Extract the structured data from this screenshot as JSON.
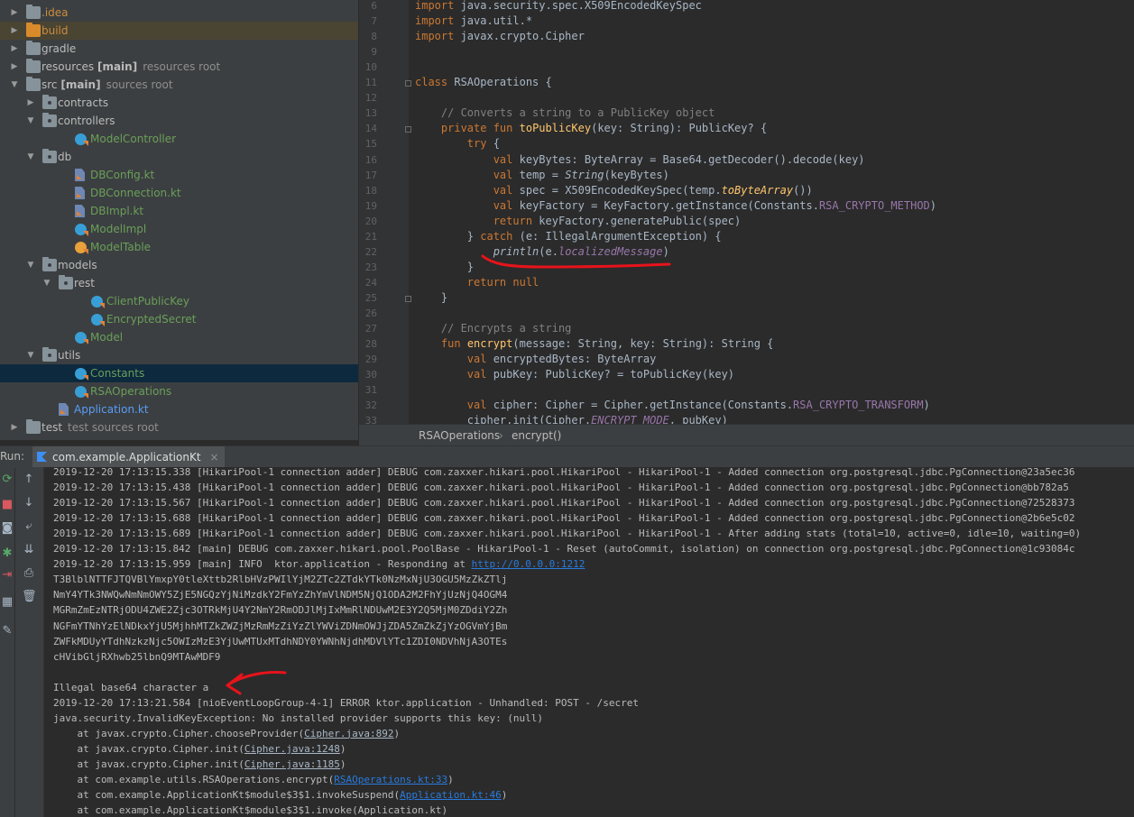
{
  "tree": [
    {
      "label": ".idea",
      "icon": "folder-icon",
      "folder": "gray",
      "arrow": "right",
      "indent": 0,
      "color": "orange",
      "hl": false
    },
    {
      "label": "build",
      "icon": "folder-icon",
      "folder": "orange",
      "arrow": "right",
      "indent": 0,
      "color": "orange",
      "hl": true
    },
    {
      "label": "gradle",
      "icon": "folder-icon",
      "folder": "gray",
      "arrow": "right",
      "indent": 0,
      "color": "gray"
    },
    {
      "label": "resources [main]",
      "hint": "resources root",
      "icon": "folder-icon",
      "folder": "gray",
      "arrow": "right",
      "indent": 0,
      "color": "gray",
      "bold_part": "[main]"
    },
    {
      "label": "src [main]",
      "hint": "sources root",
      "icon": "folder-icon",
      "folder": "gray",
      "arrow": "down",
      "indent": 0,
      "color": "gray",
      "bold_part": "[main]"
    },
    {
      "label": "contracts",
      "icon": "package-icon",
      "folder": "pkg",
      "arrow": "right",
      "indent": 1,
      "color": "gray"
    },
    {
      "label": "controllers",
      "icon": "package-icon",
      "folder": "pkg",
      "arrow": "down",
      "indent": 1,
      "color": "gray"
    },
    {
      "label": "ModelController",
      "icon": "kotlin-class-icon",
      "kt": "class",
      "indent": 2,
      "color": "green"
    },
    {
      "label": "db",
      "icon": "package-icon",
      "folder": "pkg",
      "arrow": "down",
      "indent": 1,
      "color": "gray"
    },
    {
      "label": "DBConfig.kt",
      "icon": "kotlin-file-icon",
      "kt": "file",
      "indent": 2,
      "color": "green"
    },
    {
      "label": "DBConnection.kt",
      "icon": "kotlin-file-icon",
      "kt": "file",
      "indent": 2,
      "color": "green"
    },
    {
      "label": "DBImpl.kt",
      "icon": "kotlin-file-icon",
      "kt": "file",
      "indent": 2,
      "color": "green"
    },
    {
      "label": "ModelImpl",
      "icon": "kotlin-class-icon",
      "kt": "class",
      "indent": 2,
      "color": "green"
    },
    {
      "label": "ModelTable",
      "icon": "kotlin-object-icon",
      "kt": "object",
      "indent": 2,
      "color": "green"
    },
    {
      "label": "models",
      "icon": "package-icon",
      "folder": "pkg",
      "arrow": "down",
      "indent": 1,
      "color": "gray"
    },
    {
      "label": "rest",
      "icon": "package-icon",
      "folder": "pkg",
      "arrow": "down",
      "indent": 2,
      "color": "gray"
    },
    {
      "label": "ClientPublicKey",
      "icon": "kotlin-class-icon",
      "kt": "class",
      "indent": 3,
      "color": "green"
    },
    {
      "label": "EncryptedSecret",
      "icon": "kotlin-class-icon",
      "kt": "class",
      "indent": 3,
      "color": "green"
    },
    {
      "label": "Model",
      "icon": "kotlin-class-icon",
      "kt": "class",
      "indent": 2,
      "color": "green"
    },
    {
      "label": "utils",
      "icon": "package-icon",
      "folder": "pkg",
      "arrow": "down",
      "indent": 1,
      "color": "gray"
    },
    {
      "label": "Constants",
      "icon": "kotlin-class-icon",
      "kt": "class",
      "indent": 2,
      "color": "green",
      "sel": true
    },
    {
      "label": "RSAOperations",
      "icon": "kotlin-class-icon",
      "kt": "class",
      "indent": 2,
      "color": "green"
    },
    {
      "label": "Application.kt",
      "icon": "kotlin-file-icon",
      "kt": "file",
      "indent": 1,
      "color": "blue"
    },
    {
      "label": "test",
      "hint": "test sources root",
      "icon": "folder-icon",
      "folder": "gray",
      "arrow": "right",
      "indent": 0,
      "color": "gray"
    }
  ],
  "editor": {
    "lines": [
      {
        "n": "6",
        "html": "<span class='kw'>import</span> java.security.spec.X509EncodedKeySpec"
      },
      {
        "n": "7",
        "html": "<span class='kw'>import</span> java.util.*"
      },
      {
        "n": "8",
        "html": "<span class='kw'>import</span> javax.crypto.Cipher"
      },
      {
        "n": "9",
        "html": ""
      },
      {
        "n": "10",
        "html": ""
      },
      {
        "n": "11",
        "html": "<span class='kw'>class</span> RSAOperations {"
      },
      {
        "n": "12",
        "html": ""
      },
      {
        "n": "13",
        "html": "    <span class='cm'>// Converts a string to a PublicKey object</span>"
      },
      {
        "n": "14",
        "html": "    <span class='kw'>private fun</span> <span class='fn'>toPublicKey</span>(key: String): PublicKey? {"
      },
      {
        "n": "15",
        "html": "        <span class='kw'>try</span> {"
      },
      {
        "n": "16",
        "html": "            <span class='kw'>val</span> keyBytes: ByteArray = Base64.getDecoder().decode(key)"
      },
      {
        "n": "17",
        "html": "            <span class='kw'>val</span> temp = <span class='it'>String</span>(keyBytes)"
      },
      {
        "n": "18",
        "html": "            <span class='kw'>val</span> spec = X509EncodedKeySpec(temp.<span class='ext'>toByteArray</span>())"
      },
      {
        "n": "19",
        "html": "            <span class='kw'>val</span> keyFactory = KeyFactory.getInstance(Constants.<span class='cst'>RSA_CRYPTO_METHOD</span>)"
      },
      {
        "n": "20",
        "html": "            <span class='kw'>return</span> keyFactory.generatePublic(spec)"
      },
      {
        "n": "21",
        "html": "        } <span class='kw'>catch</span> (e: IllegalArgumentException) {"
      },
      {
        "n": "22",
        "html": "            <span class='it'>println</span>(e.<span class='cst it'>localizedMessage</span>)"
      },
      {
        "n": "23",
        "html": "        }"
      },
      {
        "n": "24",
        "html": "        <span class='kw'>return null</span>"
      },
      {
        "n": "25",
        "html": "    }"
      },
      {
        "n": "26",
        "html": ""
      },
      {
        "n": "27",
        "html": "    <span class='cm'>// Encrypts a string</span>"
      },
      {
        "n": "28",
        "html": "    <span class='kw'>fun</span> <span class='fn'>encrypt</span>(message: String, key: String): String {"
      },
      {
        "n": "29",
        "html": "        <span class='kw'>val</span> encryptedBytes: ByteArray"
      },
      {
        "n": "30",
        "html": "        <span class='kw'>val</span> pubKey: PublicKey? = toPublicKey(key)"
      },
      {
        "n": "31",
        "html": ""
      },
      {
        "n": "32",
        "html": "        <span class='kw'>val</span> cipher: Cipher = Cipher.getInstance(Constants.<span class='cst'>RSA_CRYPTO_TRANSFORM</span>)"
      },
      {
        "n": "33",
        "html": "        cipher.init(Cipher.<span class='cst it'>ENCRYPT_MODE</span>, pubKey)"
      }
    ]
  },
  "breadcrumb": {
    "class_name": "RSAOperations",
    "separator": "›",
    "function_name": "encrypt()"
  },
  "run": {
    "label": "Run:",
    "tab_title": "com.example.ApplicationKt",
    "close": "×"
  },
  "console": [
    {
      "html": "2019-12-20 17:13:15.338 [HikariPool-1 connection adder] DEBUG com.zaxxer.hikari.pool.HikariPool - HikariPool-1 - Added connection org.postgresql.jdbc.PgConnection@23a5ec36"
    },
    {
      "html": "2019-12-20 17:13:15.438 [HikariPool-1 connection adder] DEBUG com.zaxxer.hikari.pool.HikariPool - HikariPool-1 - Added connection org.postgresql.jdbc.PgConnection@bb782a5"
    },
    {
      "html": "2019-12-20 17:13:15.567 [HikariPool-1 connection adder] DEBUG com.zaxxer.hikari.pool.HikariPool - HikariPool-1 - Added connection org.postgresql.jdbc.PgConnection@72528373"
    },
    {
      "html": "2019-12-20 17:13:15.688 [HikariPool-1 connection adder] DEBUG com.zaxxer.hikari.pool.HikariPool - HikariPool-1 - Added connection org.postgresql.jdbc.PgConnection@2b6e5c02"
    },
    {
      "html": "2019-12-20 17:13:15.689 [HikariPool-1 connection adder] DEBUG com.zaxxer.hikari.pool.HikariPool - HikariPool-1 - After adding stats (total=10, active=0, idle=10, waiting=0)"
    },
    {
      "html": "2019-12-20 17:13:15.842 [main] DEBUG com.zaxxer.hikari.pool.PoolBase - HikariPool-1 - Reset (autoCommit, isolation) on connection org.postgresql.jdbc.PgConnection@1c93084c"
    },
    {
      "html": "2019-12-20 17:13:15.959 [main] INFO  ktor.application - Responding at <span class='lnk'>http://0.0.0.0:1212</span>"
    },
    {
      "html": "T3BlblNTTFJTQVBlYmxpY0tleXttb2RlbHVzPWIlYjM2ZTc2ZTdkYTk0NzMxNjU3OGU5MzZkZTlj"
    },
    {
      "html": "NmY4YTk3NWQwNmNmOWY5ZjE5NGQzYjNiMzdkY2FmYzZhYmVlNDM5NjQ1ODA2M2FhYjUzNjQ4OGM4"
    },
    {
      "html": "MGRmZmEzNTRjODU4ZWE2Zjc3OTRkMjU4Y2NmY2RmODJlMjIxMmRlNDUwM2E3Y2Q5MjM0ZDdiY2Zh"
    },
    {
      "html": "NGFmYTNhYzElNDkxYjU5MjhhMTZkZWZjMzRmMzZiYzZlYWViZDNmOWJjZDA5ZmZkZjYzOGVmYjBm"
    },
    {
      "html": "ZWFkMDUyYTdhNzkzNjc5OWIzMzE3YjUwMTUxMTdhNDY0YWNhNjdhMDVlYTc1ZDI0NDVhNjA3OTEs"
    },
    {
      "html": "cHVibGljRXhwb25lbnQ9MTAwMDF9"
    },
    {
      "html": ""
    },
    {
      "html": "Illegal base64 character a"
    },
    {
      "html": "2019-12-20 17:13:21.584 [nioEventLoopGroup-4-1] ERROR ktor.application - Unhandled: POST - /secret"
    },
    {
      "html": "java.security.InvalidKeyException: No installed provider supports this key: (null)"
    },
    {
      "html": "    at javax.crypto.Cipher.chooseProvider(<span class='grayu'>Cipher.java:892</span>)"
    },
    {
      "html": "    at javax.crypto.Cipher.init(<span class='grayu'>Cipher.java:1248</span>)"
    },
    {
      "html": "    at javax.crypto.Cipher.init(<span class='grayu'>Cipher.java:1185</span>)"
    },
    {
      "html": "    at com.example.utils.RSAOperations.encrypt(<span class='lnk'>RSAOperations.kt:33</span>)"
    },
    {
      "html": "    at com.example.ApplicationKt$module$3$1.invokeSuspend(<span class='lnk'>Application.kt:46</span>)"
    },
    {
      "html": "    at com.example.ApplicationKt$module$3$1.invoke(Application.kt)"
    }
  ],
  "toolbar_icons": [
    "rerun-icon",
    "stop-icon",
    "camera-icon",
    "exit-icon",
    "pin-icon"
  ],
  "toolbar_icons_right": [
    "up-arrow-icon",
    "down-arrow-icon",
    "soft-wrap-icon",
    "scroll-to-end-icon",
    "print-icon",
    "trash-icon"
  ],
  "colors": {
    "annotation": "#e8131b",
    "accent": "#287bde"
  }
}
